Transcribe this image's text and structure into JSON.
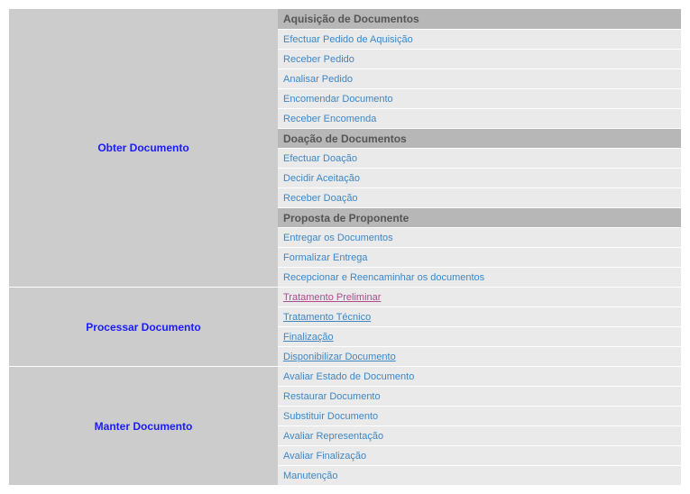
{
  "sections": [
    {
      "title": "Obter Documento",
      "rows": [
        {
          "type": "header",
          "text": "Aquisição de Documentos"
        },
        {
          "type": "item",
          "text": "Efectuar Pedido de Aquisição"
        },
        {
          "type": "item",
          "text": "Receber Pedido"
        },
        {
          "type": "item",
          "text": "Analisar Pedido"
        },
        {
          "type": "item",
          "text": "Encomendar Documento"
        },
        {
          "type": "item",
          "text": "Receber Encomenda"
        },
        {
          "type": "header",
          "text": "Doação de Documentos"
        },
        {
          "type": "item",
          "text": "Efectuar Doação"
        },
        {
          "type": "item",
          "text": "Decidir Aceitação"
        },
        {
          "type": "item",
          "text": "Receber Doação"
        },
        {
          "type": "header",
          "text": "Proposta de Proponente"
        },
        {
          "type": "item",
          "text": "Entregar os Documentos"
        },
        {
          "type": "item",
          "text": "Formalizar Entrega"
        },
        {
          "type": "item",
          "text": "Recepcionar e Reencaminhar os documentos"
        }
      ]
    },
    {
      "title": "Processar Documento",
      "rows": [
        {
          "type": "link",
          "text": "Tratamento Preliminar",
          "visited": true
        },
        {
          "type": "link",
          "text": "Tratamento Técnico",
          "visited": false
        },
        {
          "type": "link",
          "text": "Finalização",
          "visited": false
        },
        {
          "type": "link",
          "text": "Disponibilizar Documento",
          "visited": false
        }
      ]
    },
    {
      "title": "Manter Documento",
      "rows": [
        {
          "type": "item",
          "text": "Avaliar Estado de Documento"
        },
        {
          "type": "item",
          "text": "Restaurar Documento"
        },
        {
          "type": "item",
          "text": "Substituir Documento"
        },
        {
          "type": "item",
          "text": "Avaliar Representação"
        },
        {
          "type": "item",
          "text": "Avaliar Finalização"
        },
        {
          "type": "item",
          "text": "Manutenção"
        }
      ]
    }
  ]
}
